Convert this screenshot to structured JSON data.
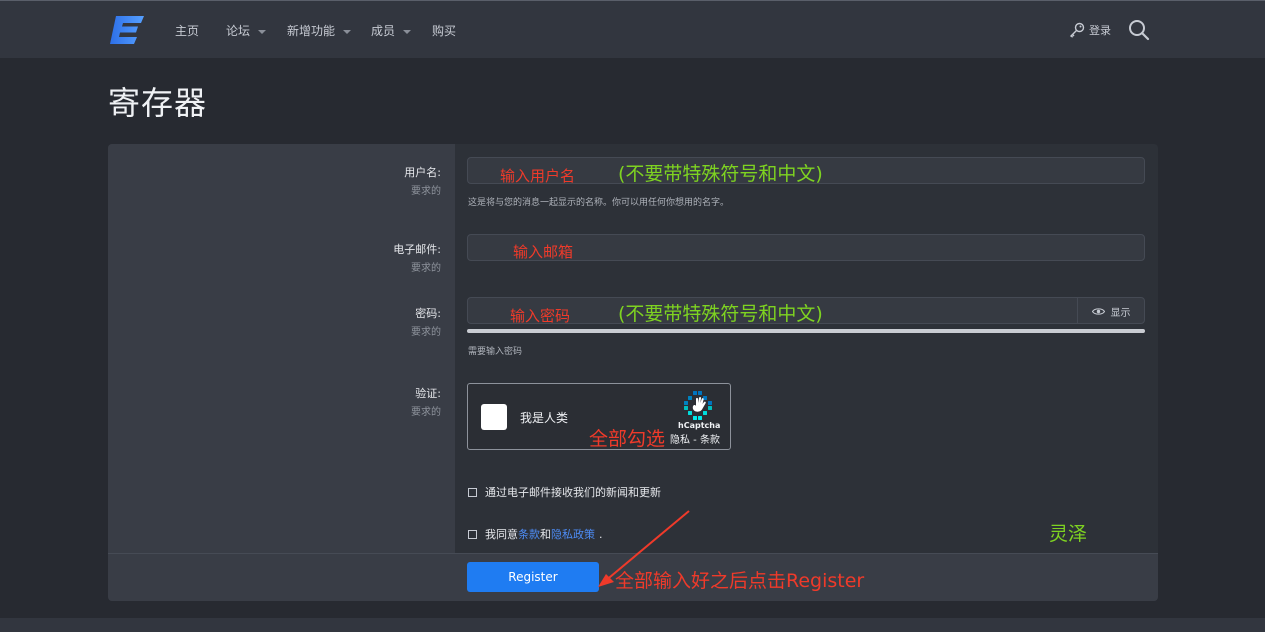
{
  "nav": {
    "items": [
      {
        "label": "主页",
        "has_caret": false
      },
      {
        "label": "论坛",
        "has_caret": true
      },
      {
        "label": "新增功能",
        "has_caret": true
      },
      {
        "label": "成员",
        "has_caret": true
      },
      {
        "label": "购买",
        "has_caret": false
      }
    ],
    "login_label": "登录",
    "login_icon": "key-icon",
    "search_icon": "search-icon",
    "logo_color": "#3d7ff2"
  },
  "page": {
    "title": "寄存器"
  },
  "form": {
    "username": {
      "label": "用户名:",
      "required": "要求的",
      "hint": "这是将与您的消息一起显示的名称。你可以用任何你想用的名字。"
    },
    "email": {
      "label": "电子邮件:",
      "required": "要求的"
    },
    "password": {
      "label": "密码:",
      "required": "要求的",
      "show_label": "显示",
      "show_icon": "eye-icon",
      "hint": "需要输入密码"
    },
    "verification": {
      "label": "验证:",
      "required": "要求的",
      "captcha_label": "我是人类",
      "captcha_brand": "hCaptcha",
      "captcha_links": "隐私 - 条款"
    },
    "newsletter_label": "通过电子邮件接收我们的新闻和更新",
    "agree": {
      "prefix": "我同意",
      "terms": "条款",
      "and": "和",
      "privacy": "隐私政策",
      "suffix": "."
    },
    "submit_label": "Register"
  },
  "annotations": {
    "username": "输入用户名",
    "username_note": "(不要带特殊符号和中文)",
    "email": "输入邮箱",
    "password": "输入密码",
    "password_note": "(不要带特殊符号和中文)",
    "check_all": "全部勾选",
    "signature": "灵泽",
    "click_register": "全部输入好之后点击Register"
  },
  "colors": {
    "accent": "#1f7cf2",
    "annotation_red": "#ef3a2a",
    "annotation_green": "#7ed321",
    "link": "#4d8cf5"
  }
}
